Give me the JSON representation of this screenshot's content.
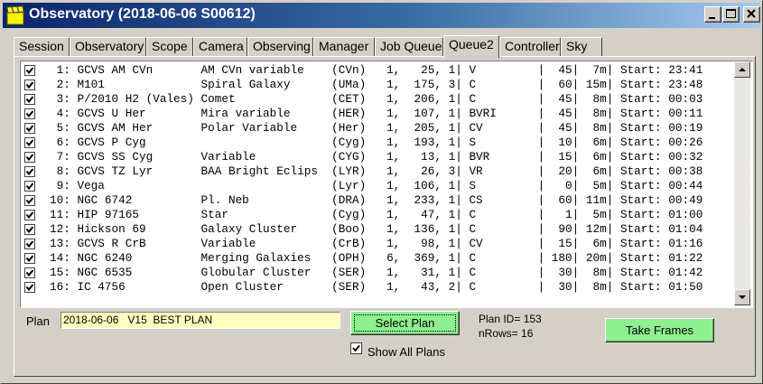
{
  "window": {
    "title": "Observatory (2018-06-06 S00612)",
    "title_color": "#0a246a"
  },
  "tabs": [
    {
      "label": "Session"
    },
    {
      "label": "Observatory"
    },
    {
      "label": "Scope"
    },
    {
      "label": "Camera"
    },
    {
      "label": "Observing"
    },
    {
      "label": "Manager"
    },
    {
      "label": "Job Queue"
    },
    {
      "label": "Queue2",
      "active": true
    },
    {
      "label": "Controller"
    },
    {
      "label": "Sky"
    }
  ],
  "queue": {
    "rows": [
      {
        "checked": true,
        "text": " 1: GCVS AM CVn       AM CVn variable    (CVn)   1,   25, 1| V         |  45|  7m| Start: 23:41"
      },
      {
        "checked": true,
        "text": " 2: M101              Spiral Galaxy      (UMa)   1,  175, 3| C         |  60| 15m| Start: 23:48"
      },
      {
        "checked": true,
        "text": " 3: P/2010 H2 (Vales) Comet              (CET)   1,  206, 1| C         |  45|  8m| Start: 00:03"
      },
      {
        "checked": true,
        "text": " 4: GCVS U Her        Mira variable      (HER)   1,  107, 1| BVRI      |  45|  8m| Start: 00:11"
      },
      {
        "checked": true,
        "text": " 5: GCVS AM Her       Polar Variable     (Her)   1,  205, 1| CV        |  45|  8m| Start: 00:19"
      },
      {
        "checked": true,
        "text": " 6: GCVS P Cyg                           (Cyg)   1,  193, 1| S         |  10|  6m| Start: 00:26"
      },
      {
        "checked": true,
        "text": " 7: GCVS SS Cyg       Variable           (CYG)   1,   13, 1| BVR       |  15|  6m| Start: 00:32"
      },
      {
        "checked": true,
        "text": " 8: GCVS TZ Lyr       BAA Bright Eclips  (LYR)   1,   26, 3| VR        |  20|  6m| Start: 00:38"
      },
      {
        "checked": true,
        "text": " 9: Vega                                 (Lyr)   1,  106, 1| S         |   0|  5m| Start: 00:44"
      },
      {
        "checked": true,
        "text": "10: NGC 6742          Pl. Neb            (DRA)   1,  233, 1| CS        |  60| 11m| Start: 00:49"
      },
      {
        "checked": true,
        "text": "11: HIP 97165         Star               (Cyg)   1,   47, 1| C         |   1|  5m| Start: 01:00"
      },
      {
        "checked": true,
        "text": "12: Hickson 69        Galaxy Cluster     (Boo)   1,  136, 1| C         |  90| 12m| Start: 01:04"
      },
      {
        "checked": true,
        "text": "13: GCVS R CrB        Variable           (CrB)   1,   98, 1| CV        |  15|  6m| Start: 01:16"
      },
      {
        "checked": true,
        "text": "14: NGC 6240          Merging Galaxies   (OPH)   6,  369, 1| C         | 180| 20m| Start: 01:22"
      },
      {
        "checked": true,
        "text": "15: NGC 6535          Globular Cluster   (SER)   1,   31, 1| C         |  30|  8m| Start: 01:42"
      },
      {
        "checked": true,
        "text": "16: IC 4756           Open Cluster       (SER)   1,   43, 2| C         |  30|  8m| Start: 01:50"
      }
    ]
  },
  "plan": {
    "label": "Plan",
    "value": "2018-06-06   V15  BEST PLAN",
    "select_button": "Select Plan",
    "plan_id": "Plan ID= 153",
    "nrows": "nRows= 16",
    "show_all_label": "Show All Plans",
    "show_all_checked": true,
    "take_frames_button": "Take Frames",
    "button_color": "#8ef08e",
    "input_color": "#ffffc0"
  },
  "icons": {
    "app": "clapperboard-icon",
    "minimize": "minimize-icon",
    "maximize": "maximize-icon",
    "close": "close-icon",
    "scroll_up": "arrow-up-icon",
    "scroll_down": "arrow-down-icon",
    "check": "checkmark-icon"
  }
}
